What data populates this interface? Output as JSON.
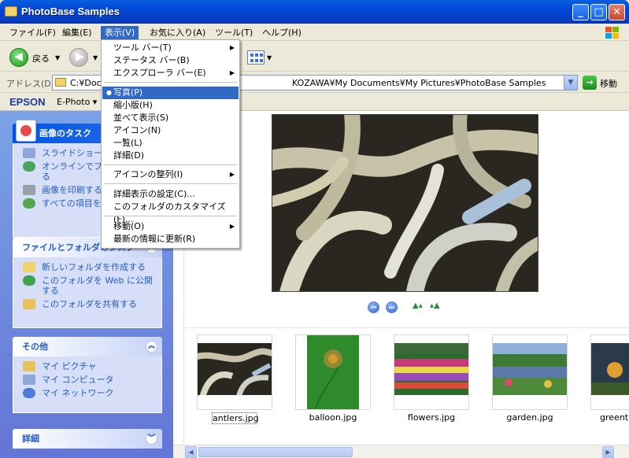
{
  "window": {
    "title": "PhotoBase Samples"
  },
  "menubar": {
    "items": [
      "ファイル(F)",
      "編集(E)",
      "表示(V)",
      "お気に入り(A)",
      "ツール(T)",
      "ヘルプ(H)"
    ]
  },
  "toolbar": {
    "back_label": "戻る"
  },
  "address": {
    "label": "アドレス(D)",
    "value_start": "C:¥Doc",
    "value_end": "KOZAWA¥My Documents¥My Pictures¥PhotoBase Samples",
    "go_label": "移動"
  },
  "epsonbar": {
    "logo": "EPSON",
    "ephoto": "E-Photo ▾"
  },
  "view_menu": {
    "items": [
      {
        "label": "ツール バー(T)",
        "submenu": true
      },
      {
        "label": "ステータス バー(B)"
      },
      {
        "label": "エクスプローラ バー(E)",
        "submenu": true
      },
      {
        "label": "写真(P)",
        "selected": true
      },
      {
        "label": "縮小版(H)"
      },
      {
        "label": "並べて表示(S)"
      },
      {
        "label": "アイコン(N)"
      },
      {
        "label": "一覧(L)"
      },
      {
        "label": "詳細(D)"
      },
      {
        "label": "アイコンの整列(I)",
        "submenu": true
      },
      {
        "label": "詳細表示の設定(C)..."
      },
      {
        "label": "このフォルダのカスタマイズ(F)..."
      },
      {
        "label": "移動(O)",
        "submenu": true
      },
      {
        "label": "最新の情報に更新(R)"
      }
    ]
  },
  "sidebar": {
    "image_tasks": {
      "title": "画像のタスク",
      "items": [
        "スライドショーを表",
        "オンラインでプリン",
        "る",
        "画像を印刷する",
        "すべての項目を"
      ]
    },
    "file_tasks": {
      "title": "ファイルとフォルダのタスク",
      "items": [
        "新しいフォルダを作成する",
        "このフォルダを Web に公開",
        "する",
        "このフォルダを共有する"
      ]
    },
    "other": {
      "title": "その他",
      "items": [
        "マイ ピクチャ",
        "マイ コンピュータ",
        "マイ ネットワーク"
      ]
    },
    "details": {
      "title": "詳細"
    }
  },
  "thumbnails": [
    {
      "name": "antlers.jpg",
      "selected": true
    },
    {
      "name": "balloon.jpg"
    },
    {
      "name": "flowers.jpg"
    },
    {
      "name": "garden.jpg"
    },
    {
      "name": "greent"
    }
  ],
  "colors": {
    "titlebar": "#0054e3",
    "menu_highlight": "#316ac5",
    "sidebar_link": "#215dc6"
  }
}
